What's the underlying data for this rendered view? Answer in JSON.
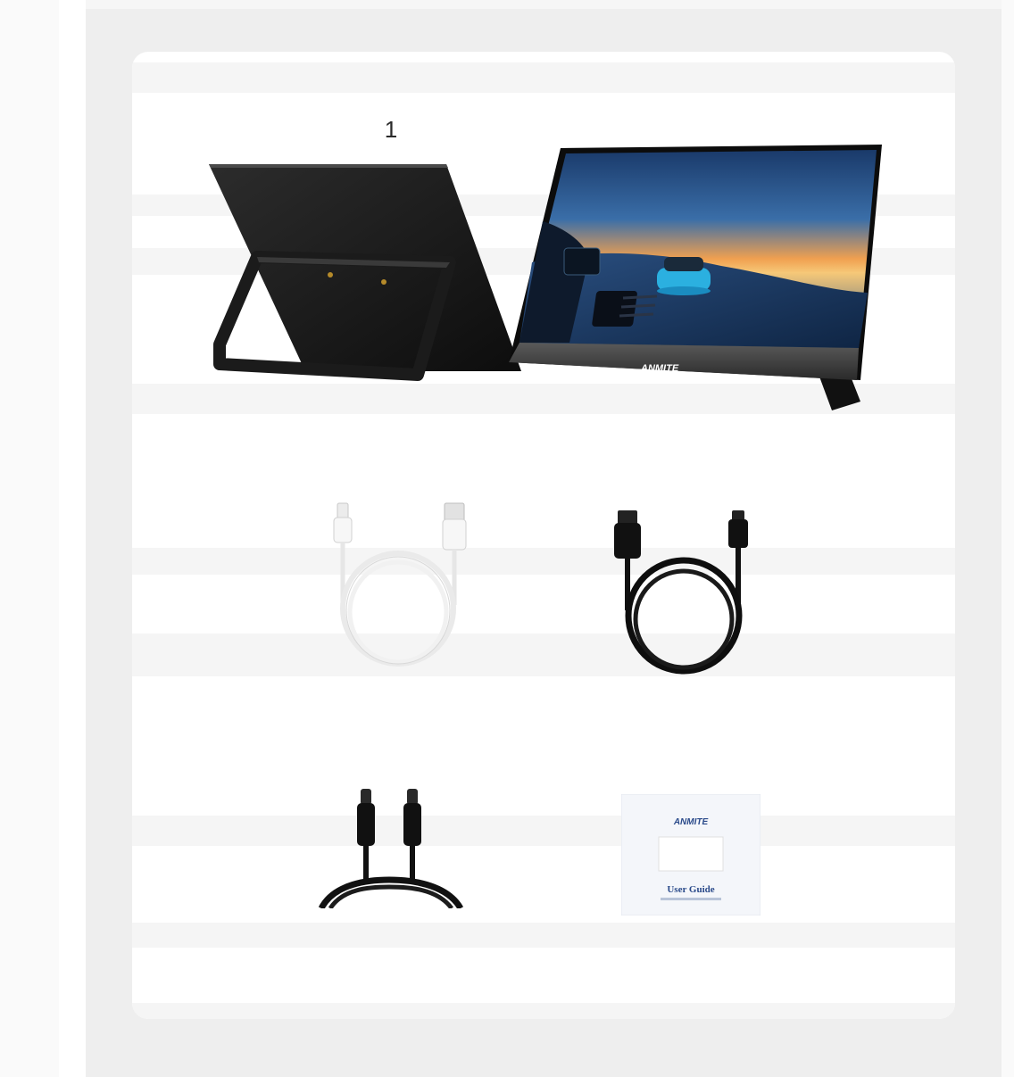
{
  "figure": {
    "label": "1",
    "brand": "ANMITE",
    "manual_title": "User Guide"
  },
  "items": [
    {
      "name": "portable-monitor-back"
    },
    {
      "name": "portable-monitor-front"
    },
    {
      "name": "usb-c-to-usb-a-cable",
      "color": "#ffffff"
    },
    {
      "name": "hdmi-to-mini-hdmi-cable",
      "color": "#111111"
    },
    {
      "name": "usb-c-to-usb-c-cable",
      "color": "#111111"
    },
    {
      "name": "user-guide-booklet"
    }
  ]
}
